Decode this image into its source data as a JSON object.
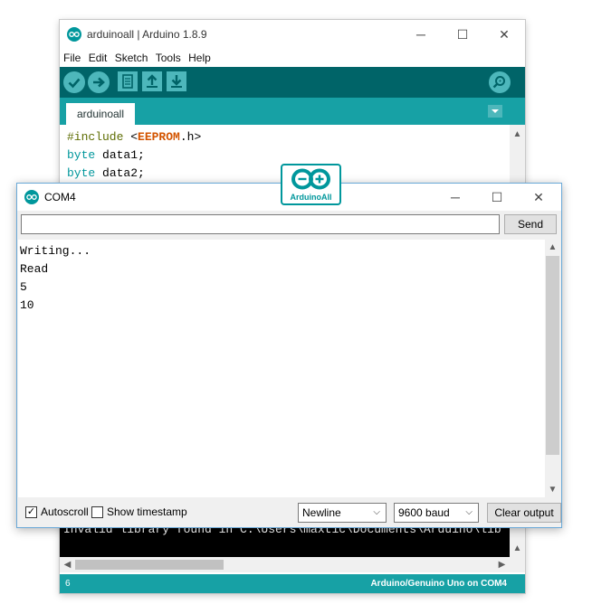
{
  "ide": {
    "window_title": "arduinoall | Arduino 1.8.9",
    "window_controls": {
      "minimize": "─",
      "maximize": "☐",
      "close": "✕"
    },
    "menu": [
      "File",
      "Edit",
      "Sketch",
      "Tools",
      "Help"
    ],
    "toolbar_icons": [
      "verify-icon",
      "upload-icon",
      "new-icon",
      "open-icon",
      "save-icon",
      "serial-monitor-icon"
    ],
    "tab_label": "arduinoall",
    "code": {
      "line1": {
        "directive": "#include",
        "lt": " <",
        "lib": "EEPROM",
        "rest": ".h>"
      },
      "line2": {
        "type": "byte",
        "rest": " data1;"
      },
      "line3": {
        "type": "byte",
        "rest": " data2;"
      }
    },
    "console_line": "Invalid library found in C:\\Users\\maxtic\\Documents\\Arduino\\lib",
    "status_line": "6",
    "status_board": "Arduino/Genuino Uno on COM4"
  },
  "logo": {
    "text": "ArduinoAll"
  },
  "monitor": {
    "window_title": "COM4",
    "window_controls": {
      "minimize": "─",
      "maximize": "☐",
      "close": "✕"
    },
    "input_value": "",
    "send_label": "Send",
    "output_lines": [
      "Writing...",
      "Read",
      "5",
      "10"
    ],
    "autoscroll_label": "Autoscroll",
    "autoscroll_checked": "✓",
    "timestamp_label": "Show timestamp",
    "line_ending": "Newline",
    "baud_rate": "9600 baud",
    "clear_label": "Clear output"
  },
  "colors": {
    "teal_dark": "#006468",
    "teal_mid": "#17a1a5",
    "teal_light": "#4db7bb",
    "accent": "#00979c"
  }
}
